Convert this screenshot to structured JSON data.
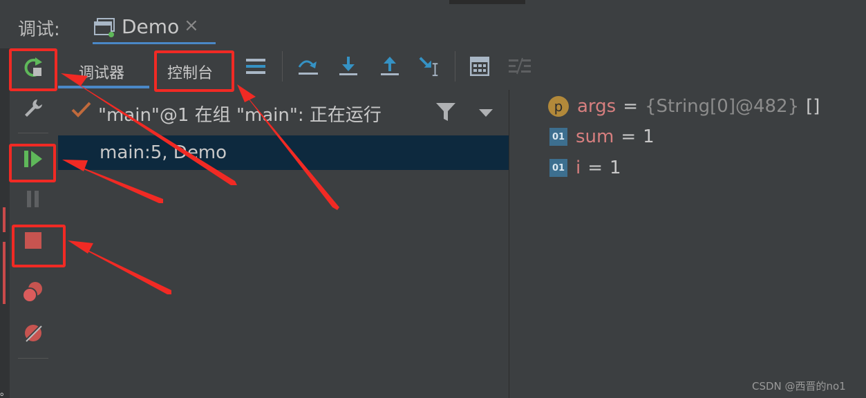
{
  "header": {
    "label": "调试:",
    "tab": {
      "label": "Demo",
      "close_glyph": "×",
      "icon": "window-icon"
    }
  },
  "side_toolbar": {
    "buttons": [
      {
        "icon": "rerun-icon"
      },
      {
        "icon": "wrench-icon"
      },
      {
        "icon": "resume-icon"
      },
      {
        "icon": "pause-icon"
      },
      {
        "icon": "stop-icon"
      },
      {
        "icon": "view-breakpoints-icon"
      },
      {
        "icon": "mute-breakpoints-icon"
      }
    ]
  },
  "sub_toolbar": {
    "tabs": [
      {
        "label": "调试器"
      },
      {
        "label": "控制台"
      }
    ],
    "icons": [
      "layout-icon",
      "step-over-icon",
      "step-into-icon",
      "step-out-icon",
      "run-to-cursor-icon",
      "evaluate-icon",
      "trace-icon"
    ]
  },
  "frames": {
    "thread": "\"main\"@1 在组 \"main\": 正在运行",
    "selected_frame": "main:5, Demo"
  },
  "variables": [
    {
      "badge": "p",
      "name": "args",
      "value": "{String[0]@482}",
      "extra": "[]"
    },
    {
      "badge": "01",
      "name": "sum",
      "value": "1"
    },
    {
      "badge": "01",
      "name": "i",
      "value": "1"
    }
  ],
  "colors": {
    "annotation": "#f12a24",
    "accent": "#4a88c7",
    "selection": "#0d293e"
  },
  "watermark": "CSDN @西晋的no1",
  "left_edge_glyph": "。"
}
